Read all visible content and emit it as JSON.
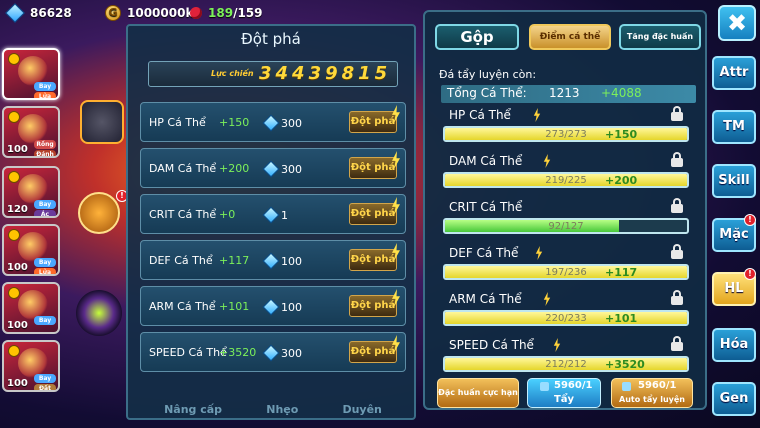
{
  "resources": {
    "gems": "86628",
    "coins": "1000000k",
    "cherry_current": "189",
    "cherry_max": "/159"
  },
  "team": [
    {
      "level": "",
      "tags": [
        "Bay",
        "Lửa"
      ]
    },
    {
      "level": "100",
      "tags": [
        "Rồng",
        "Đánh"
      ]
    },
    {
      "level": "120",
      "tags": [
        "Bay",
        "Ác"
      ]
    },
    {
      "level": "100",
      "tags": [
        "Bay",
        "Lửa"
      ]
    },
    {
      "level": "100",
      "tags": [
        "Bay"
      ]
    },
    {
      "level": "100",
      "tags": [
        "Bay",
        "Đất"
      ]
    }
  ],
  "breakthrough": {
    "title": "Đột phá",
    "power_label": "Lực chiến",
    "power_value": "34439815",
    "button_label": "Đột phá",
    "rows": [
      {
        "name": "HP Cá Thể",
        "plus": "+150",
        "cost": "300"
      },
      {
        "name": "DAM Cá Thể",
        "plus": "+200",
        "cost": "300"
      },
      {
        "name": "CRIT Cá Thể",
        "plus": "+0",
        "cost": "1"
      },
      {
        "name": "DEF Cá Thể",
        "plus": "+117",
        "cost": "100"
      },
      {
        "name": "ARM Cá Thể",
        "plus": "+101",
        "cost": "100"
      },
      {
        "name": "SPEED Cá Thể",
        "plus": "+3520",
        "cost": "300"
      }
    ],
    "bottom_tabs": [
      "Nâng cấp",
      "Nhẹo",
      "Duyên"
    ]
  },
  "right": {
    "tabs": {
      "merge": "Gộp",
      "individual_points": "Điểm cá thể",
      "special_train": "Tăng đặc huấn"
    },
    "remaining_label": "Đá tẩy luyện còn:",
    "total_label": "Tổng Cá Thể:",
    "total_value": "1213",
    "total_plus": "+4088",
    "stats": [
      {
        "name": "HP Cá Thể",
        "value": "273/273",
        "plus": "+150",
        "fill": 1.0,
        "color": "yellow",
        "bolt": true
      },
      {
        "name": "DAM Cá Thể",
        "value": "219/225",
        "plus": "+200",
        "fill": 1.0,
        "color": "yellow",
        "bolt": true
      },
      {
        "name": "CRIT Cá Thể",
        "value": "92/127",
        "plus": "",
        "fill": 0.72,
        "color": "green",
        "bolt": false
      },
      {
        "name": "DEF Cá Thể",
        "value": "197/236",
        "plus": "+117",
        "fill": 1.0,
        "color": "yellow",
        "bolt": true
      },
      {
        "name": "ARM Cá Thể",
        "value": "220/233",
        "plus": "+101",
        "fill": 1.0,
        "color": "yellow",
        "bolt": true
      },
      {
        "name": "SPEED Cá Thể",
        "value": "212/212",
        "plus": "+3520",
        "fill": 1.0,
        "color": "yellow",
        "bolt": true
      }
    ],
    "btn_special": "Đặc huấn cực hạn",
    "btn_wash_count": "5960/1",
    "btn_wash": "Tẩy",
    "btn_auto_count": "5960/1",
    "btn_auto": "Auto tẩy luyện"
  },
  "sidebar": [
    "Attr",
    "TM",
    "Skill",
    "Mặc",
    "HL",
    "Hóa",
    "Gen"
  ],
  "badge_mark": "!",
  "close_glyph": "✖",
  "coin_glyph": "G"
}
